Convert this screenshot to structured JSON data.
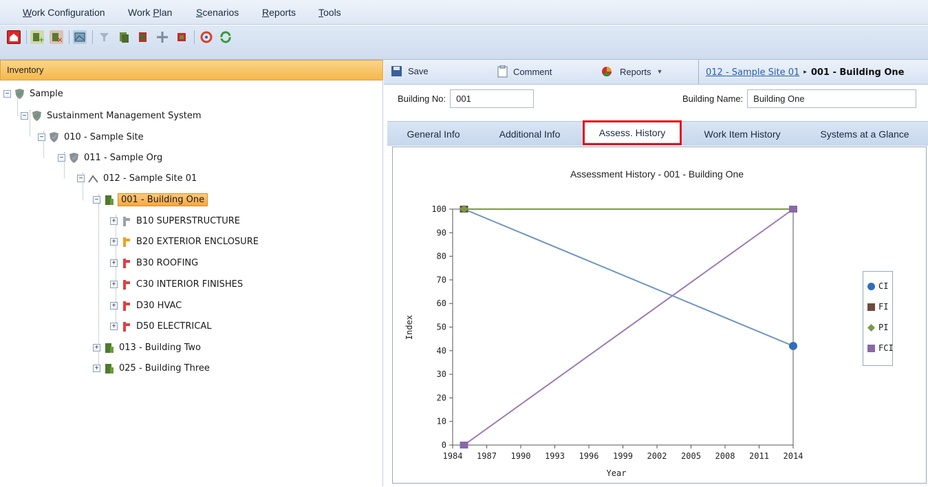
{
  "menu": {
    "items": [
      {
        "label": "Work Configuration",
        "key": "W"
      },
      {
        "label": "Work Plan",
        "key": "P"
      },
      {
        "label": "Scenarios",
        "key": "S"
      },
      {
        "label": "Reports",
        "key": "R"
      },
      {
        "label": "Tools",
        "key": "T"
      }
    ]
  },
  "toolbar_icons": [
    "home-icon",
    "add-building-icon",
    "delete-building-icon",
    "map-icon",
    "filter-icon",
    "copy-icon",
    "book-icon",
    "move-icon",
    "export-icon",
    "refresh-icon",
    "sync-icon"
  ],
  "inventory": {
    "header": "Inventory",
    "tree": [
      {
        "label": "Sample"
      },
      {
        "label": "Sustainment Management System"
      },
      {
        "label": "010 - Sample Site"
      },
      {
        "label": "011 - Sample Org"
      },
      {
        "label": "012 - Sample Site 01"
      },
      {
        "label": "001 - Building One"
      },
      {
        "label": "B10 SUPERSTRUCTURE"
      },
      {
        "label": "B20 EXTERIOR ENCLOSURE"
      },
      {
        "label": "B30 ROOFING"
      },
      {
        "label": "C30 INTERIOR FINISHES"
      },
      {
        "label": "D30 HVAC"
      },
      {
        "label": "D50 ELECTRICAL"
      },
      {
        "label": "013 - Building Two"
      },
      {
        "label": "025 - Building Three"
      }
    ]
  },
  "actions": {
    "save": "Save",
    "comment": "Comment",
    "reports": "Reports"
  },
  "breadcrumb": {
    "parent": "012 - Sample Site 01",
    "current": "001 - Building One"
  },
  "building": {
    "no_label": "Building No:",
    "no_value": "001",
    "name_label": "Building Name:",
    "name_value": "Building One"
  },
  "tabs": [
    {
      "label": "General Info"
    },
    {
      "label": "Additional Info"
    },
    {
      "label": "Assess. History",
      "active": true
    },
    {
      "label": "Work Item History"
    },
    {
      "label": "Systems at a Glance"
    }
  ],
  "colors": {
    "ci": "#5b8ab8",
    "fi": "#6e4a40",
    "pi": "#7a9a4a",
    "fci": "#8a68a8",
    "active_tab_border": "#e0101f"
  },
  "chart_data": {
    "type": "line",
    "title": "Assessment History - 001 - Building One",
    "xlabel": "Year",
    "ylabel": "Index",
    "xlim": [
      1984,
      2014
    ],
    "ylim": [
      0,
      100
    ],
    "xticks": [
      "1984",
      "1987",
      "1990",
      "1993",
      "1996",
      "1999",
      "2002",
      "2005",
      "2008",
      "2011",
      "2014"
    ],
    "yticks": [
      "0",
      "10",
      "20",
      "30",
      "40",
      "50",
      "60",
      "70",
      "80",
      "90",
      "100"
    ],
    "series": [
      {
        "name": "CI",
        "x": [
          1985,
          2014
        ],
        "values": [
          100,
          42
        ]
      },
      {
        "name": "FI",
        "x": [
          1985,
          2014
        ],
        "values": [
          100,
          100
        ]
      },
      {
        "name": "PI",
        "x": [
          1985,
          2014
        ],
        "values": [
          100,
          100
        ]
      },
      {
        "name": "FCI",
        "x": [
          1985,
          2014
        ],
        "values": [
          0,
          100
        ]
      }
    ],
    "legend": "right"
  }
}
